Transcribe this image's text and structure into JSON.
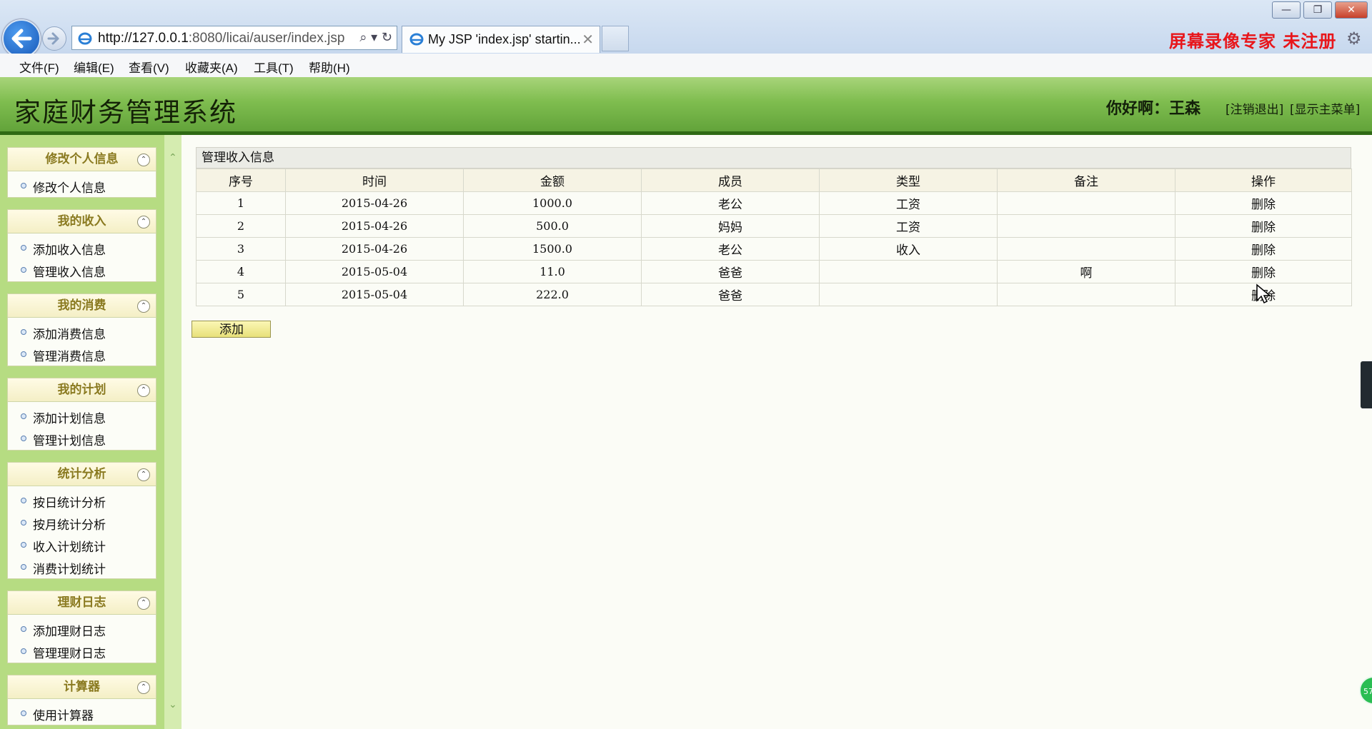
{
  "browser": {
    "url_host": "http://127.0.0.1",
    "url_rest": ":8080/licai/auser/index.jsp",
    "tab_title": "My JSP 'index.jsp' startin...",
    "watermark": "屏幕录像专家  未注册",
    "menu": [
      "文件(F)",
      "编辑(E)",
      "查看(V)",
      "收藏夹(A)",
      "工具(T)",
      "帮助(H)"
    ]
  },
  "header": {
    "title": "家庭财务管理系统",
    "greeting": "你好啊：王森",
    "logout": "[注销退出]",
    "show_menu": "[显示主菜单]"
  },
  "sidebar": {
    "groups": [
      {
        "title": "修改个人信息",
        "items": [
          "修改个人信息"
        ]
      },
      {
        "title": "我的收入",
        "items": [
          "添加收入信息",
          "管理收入信息"
        ]
      },
      {
        "title": "我的消费",
        "items": [
          "添加消费信息",
          "管理消费信息"
        ]
      },
      {
        "title": "我的计划",
        "items": [
          "添加计划信息",
          "管理计划信息"
        ]
      },
      {
        "title": "统计分析",
        "items": [
          "按日统计分析",
          "按月统计分析",
          "收入计划统计",
          "消费计划统计"
        ]
      },
      {
        "title": "理财日志",
        "items": [
          "添加理财日志",
          "管理理财日志"
        ]
      },
      {
        "title": "计算器",
        "items": [
          "使用计算器"
        ]
      }
    ]
  },
  "main": {
    "panel_title": "管理收入信息",
    "columns": [
      "序号",
      "时间",
      "金额",
      "成员",
      "类型",
      "备注",
      "操作"
    ],
    "rows": [
      [
        "1",
        "2015-04-26",
        "1000.0",
        "老公",
        "工资",
        "",
        "删除"
      ],
      [
        "2",
        "2015-04-26",
        "500.0",
        "妈妈",
        "工资",
        "",
        "删除"
      ],
      [
        "3",
        "2015-04-26",
        "1500.0",
        "老公",
        "收入",
        "",
        "删除"
      ],
      [
        "4",
        "2015-05-04",
        "11.0",
        "爸爸",
        "",
        "啊",
        "删除"
      ],
      [
        "5",
        "2015-05-04",
        "222.0",
        "爸爸",
        "",
        "",
        "删除"
      ]
    ],
    "add_label": "添加"
  },
  "widgets": {
    "bubble_text": "57"
  }
}
